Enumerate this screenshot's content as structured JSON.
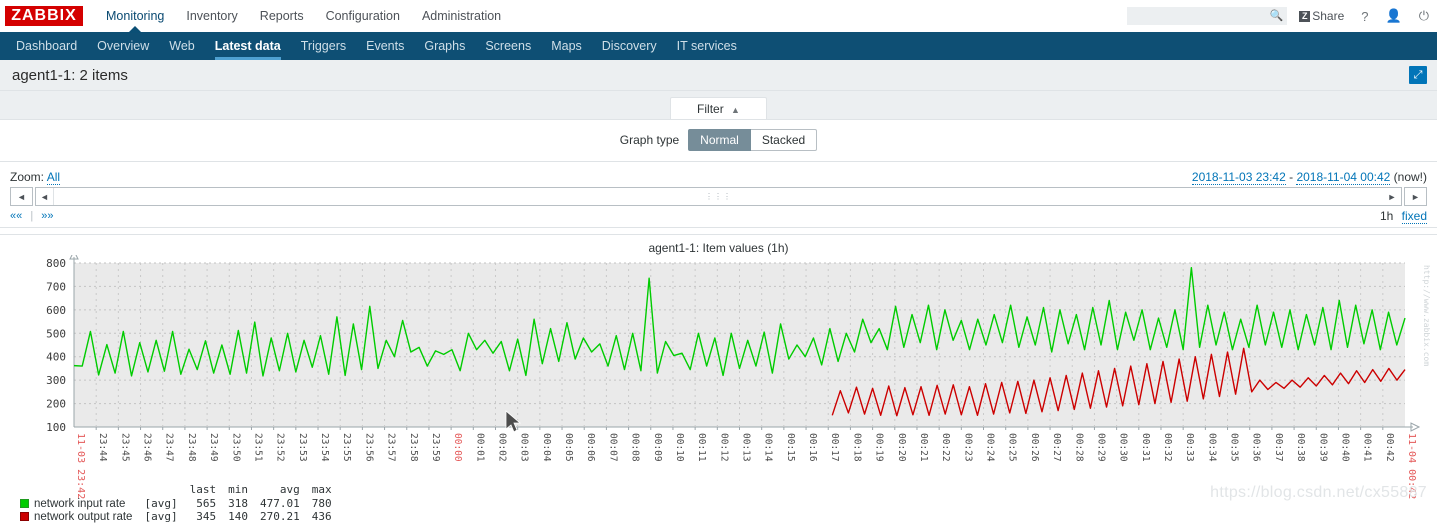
{
  "brand": {
    "logo": "ZABBIX"
  },
  "header": {
    "main_menu": [
      {
        "label": "Monitoring",
        "selected": true
      },
      {
        "label": "Inventory",
        "selected": false
      },
      {
        "label": "Reports",
        "selected": false
      },
      {
        "label": "Configuration",
        "selected": false
      },
      {
        "label": "Administration",
        "selected": false
      }
    ],
    "search": {
      "value": "",
      "placeholder": "",
      "icon": "search-icon"
    },
    "share_label": "Share",
    "share_badge": "Z",
    "help_icon": "question-mark-icon",
    "user_icon": "user-profile-icon",
    "logout_icon": "power-off-icon"
  },
  "submenu": {
    "items": [
      {
        "label": "Dashboard",
        "selected": false
      },
      {
        "label": "Overview",
        "selected": false
      },
      {
        "label": "Web",
        "selected": false
      },
      {
        "label": "Latest data",
        "selected": true
      },
      {
        "label": "Triggers",
        "selected": false
      },
      {
        "label": "Events",
        "selected": false
      },
      {
        "label": "Graphs",
        "selected": false
      },
      {
        "label": "Screens",
        "selected": false
      },
      {
        "label": "Maps",
        "selected": false
      },
      {
        "label": "Discovery",
        "selected": false
      },
      {
        "label": "IT services",
        "selected": false
      }
    ]
  },
  "page": {
    "title": "agent1-1: 2 items",
    "kiosk_icon": "expand-arrows-icon"
  },
  "filter": {
    "tab_label": "Filter",
    "tab_caret": "▲",
    "graph_type_label": "Graph type",
    "options": [
      {
        "label": "Normal",
        "selected": true
      },
      {
        "label": "Stacked",
        "selected": false
      }
    ]
  },
  "timeselector": {
    "zoom_label": "Zoom:",
    "zoom_value": "All",
    "range_from": "2018-11-03 23:42",
    "range_sep": "-",
    "range_to": "2018-11-04 00:42",
    "range_now": "(now!)",
    "left_arrow": "◄",
    "scroll_left_arrow": "◄",
    "scroll_right_arrow": "►",
    "right_arrow": "►",
    "grip": "⋮⋮",
    "nav_prev": "««",
    "nav_sep": "|",
    "nav_next": "»»",
    "period": "1h",
    "fixed_label": "fixed"
  },
  "watermarks": {
    "zabbix": "http://www.zabbix.com",
    "csdn": "https://blog.csdn.net/cx55887"
  },
  "colors": {
    "brand_red": "#d40000",
    "nav_blue": "#0e4f74",
    "accent_blue": "#0275b8",
    "series_green": "#00cc00",
    "series_red": "#cc0000",
    "plot_bg": "#eaeaea",
    "axis_red": "#e45959"
  },
  "chart_data": {
    "type": "line",
    "title": "agent1-1: Item values (1h)",
    "xlabel": "",
    "ylabel": "",
    "ylim": [
      100,
      800
    ],
    "yticks": [
      100,
      200,
      300,
      400,
      500,
      600,
      700,
      800
    ],
    "grid": true,
    "legend_position": "bottom-left",
    "boundary_labels": [
      {
        "text": "11-03 23:42",
        "position": "left",
        "color": "#e45959"
      },
      {
        "text": "11-04 00:42",
        "position": "right",
        "color": "#e45959"
      }
    ],
    "xtick_labels": [
      "23:44",
      "23:45",
      "23:46",
      "23:47",
      "23:48",
      "23:49",
      "23:50",
      "23:51",
      "23:52",
      "23:53",
      "23:54",
      "23:55",
      "23:56",
      "23:57",
      "23:58",
      "23:59",
      "00:00",
      "00:01",
      "00:02",
      "00:03",
      "00:04",
      "00:05",
      "00:06",
      "00:07",
      "00:08",
      "00:09",
      "00:10",
      "00:11",
      "00:12",
      "00:13",
      "00:14",
      "00:15",
      "00:16",
      "00:17",
      "00:18",
      "00:19",
      "00:20",
      "00:21",
      "00:22",
      "00:23",
      "00:24",
      "00:25",
      "00:26",
      "00:27",
      "00:28",
      "00:29",
      "00:30",
      "00:31",
      "00:32",
      "00:33",
      "00:34",
      "00:35",
      "00:36",
      "00:37",
      "00:38",
      "00:39",
      "00:40",
      "00:41",
      "00:42"
    ],
    "xtick_highlight": [
      "00:00"
    ],
    "legend_columns": [
      "last",
      "min",
      "avg",
      "max"
    ],
    "series": [
      {
        "name": "network input rate",
        "aggregate": "[avg]",
        "color": "#00cc00",
        "last": "565",
        "min": "318",
        "avg": "477.01",
        "max": "780",
        "values": [
          362,
          360,
          508,
          322,
          452,
          330,
          508,
          318,
          460,
          335,
          470,
          338,
          508,
          325,
          432,
          345,
          468,
          330,
          450,
          325,
          512,
          330,
          548,
          318,
          480,
          340,
          500,
          335,
          470,
          355,
          490,
          325,
          570,
          320,
          540,
          345,
          615,
          350,
          470,
          400,
          555,
          420,
          440,
          360,
          425,
          410,
          430,
          340,
          500,
          430,
          470,
          415,
          465,
          340,
          475,
          320,
          560,
          370,
          520,
          380,
          545,
          390,
          480,
          420,
          455,
          360,
          490,
          345,
          500,
          340,
          735,
          330,
          465,
          405,
          415,
          345,
          500,
          360,
          480,
          320,
          500,
          350,
          470,
          360,
          505,
          330,
          540,
          390,
          450,
          400,
          480,
          365,
          520,
          380,
          500,
          420,
          560,
          460,
          520,
          430,
          615,
          440,
          580,
          460,
          620,
          430,
          600,
          470,
          555,
          430,
          560,
          450,
          580,
          460,
          620,
          440,
          570,
          450,
          610,
          420,
          600,
          455,
          580,
          430,
          610,
          450,
          640,
          430,
          590,
          470,
          600,
          430,
          565,
          440,
          600,
          430,
          780,
          440,
          620,
          450,
          590,
          430,
          560,
          440,
          620,
          450,
          590,
          440,
          600,
          430,
          580,
          450,
          610,
          430,
          640,
          440,
          620,
          455,
          600,
          430,
          590,
          450,
          565
        ]
      },
      {
        "name": "network output rate",
        "aggregate": "[avg]",
        "color": "#cc0000",
        "last": "345",
        "min": "140",
        "avg": "270.21",
        "max": "436",
        "values": [
          null,
          null,
          null,
          null,
          null,
          null,
          null,
          null,
          null,
          null,
          null,
          null,
          null,
          null,
          null,
          null,
          null,
          null,
          null,
          null,
          null,
          null,
          null,
          null,
          null,
          null,
          null,
          null,
          null,
          null,
          null,
          null,
          null,
          null,
          null,
          null,
          null,
          null,
          null,
          null,
          null,
          null,
          null,
          null,
          null,
          null,
          null,
          null,
          null,
          null,
          null,
          null,
          null,
          null,
          null,
          null,
          null,
          null,
          null,
          null,
          null,
          null,
          null,
          null,
          null,
          null,
          null,
          null,
          null,
          null,
          null,
          null,
          null,
          null,
          null,
          null,
          null,
          null,
          null,
          null,
          null,
          null,
          null,
          null,
          null,
          null,
          null,
          null,
          null,
          null,
          null,
          null,
          null,
          null,
          150,
          255,
          160,
          270,
          155,
          265,
          150,
          275,
          148,
          268,
          152,
          272,
          150,
          278,
          155,
          280,
          152,
          272,
          150,
          285,
          155,
          290,
          160,
          295,
          158,
          300,
          165,
          310,
          170,
          320,
          175,
          330,
          180,
          340,
          185,
          350,
          190,
          360,
          195,
          370,
          200,
          380,
          205,
          390,
          210,
          400,
          220,
          410,
          230,
          420,
          240,
          436,
          250,
          300,
          260,
          290,
          265,
          300,
          270,
          310,
          275,
          320,
          280,
          330,
          285,
          340,
          290,
          345,
          295,
          350,
          300,
          345
        ]
      }
    ]
  }
}
